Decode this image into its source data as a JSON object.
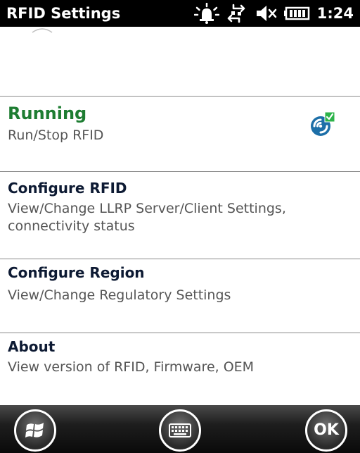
{
  "status_bar": {
    "title": "RFID Settings",
    "time": "1:24",
    "icons": [
      "notification-icon",
      "sync-icon",
      "volume-muted-icon",
      "battery-icon"
    ]
  },
  "menu": {
    "items": [
      {
        "heading": "Running",
        "description": "Run/Stop RFID",
        "icon": "rfid-status-icon",
        "heading_color": "#1e7d32"
      },
      {
        "heading": "Configure RFID",
        "description": "View/Change LLRP Server/Client Settings, connectivity status"
      },
      {
        "heading": "Configure Region",
        "description": "View/Change Regulatory Settings"
      },
      {
        "heading": "About",
        "description": "View version of RFID, Firmware, OEM"
      }
    ]
  },
  "softkeys": {
    "start_icon": "windows-start-icon",
    "keyboard_icon": "keyboard-icon",
    "ok_label": "OK"
  }
}
